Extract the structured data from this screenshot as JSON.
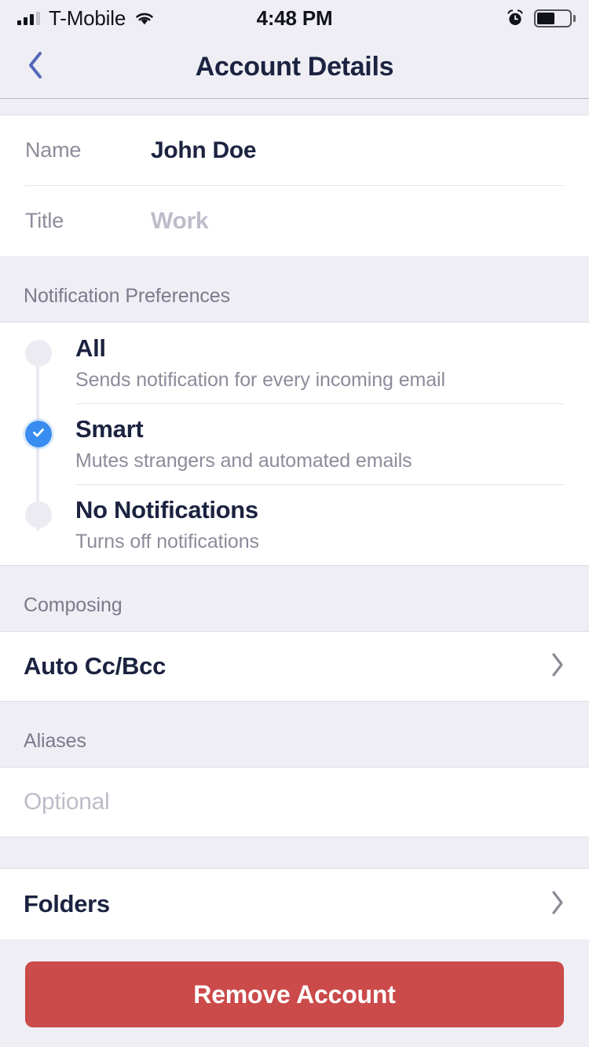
{
  "status_bar": {
    "carrier": "T-Mobile",
    "time": "4:48 PM",
    "signal_bars_filled": 3,
    "signal_bars_total": 4,
    "wifi_icon": "wifi-icon",
    "alarm_icon": "alarm-clock-icon",
    "battery_level_percent": 55
  },
  "nav": {
    "back_icon": "chevron-left-icon",
    "title": "Account Details",
    "back_color": "#5468B8",
    "title_color": "#1B2340"
  },
  "account_fields": [
    {
      "label": "Name",
      "value": "John Doe",
      "placeholder": "",
      "filled": true
    },
    {
      "label": "Title",
      "value": "",
      "placeholder": "Work",
      "filled": false
    }
  ],
  "notification_preferences": {
    "header": "Notification Preferences",
    "selected": "Smart",
    "selected_color": "#3A8DF0",
    "options": [
      {
        "title": "All",
        "subtitle": "Sends notification for every incoming email",
        "selected": false
      },
      {
        "title": "Smart",
        "subtitle": "Mutes strangers and automated emails",
        "selected": true
      },
      {
        "title": "No Notifications",
        "subtitle": "Turns off notifications",
        "selected": false
      }
    ]
  },
  "composing": {
    "header": "Composing",
    "rows": [
      {
        "label": "Auto Cc/Bcc",
        "chevron_icon": "chevron-right-icon"
      }
    ]
  },
  "aliases": {
    "header": "Aliases",
    "value": "",
    "placeholder": "Optional"
  },
  "folders": {
    "label": "Folders",
    "chevron_icon": "chevron-right-icon"
  },
  "remove_account": {
    "label": "Remove Account",
    "color": "#CB4A4A"
  }
}
